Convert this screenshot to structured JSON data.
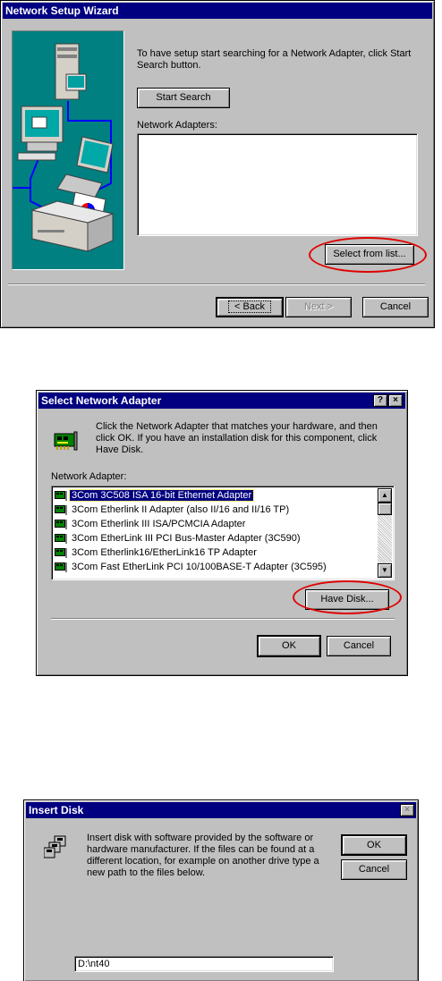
{
  "wizard": {
    "title": "Network Setup Wizard",
    "instruction": "To have setup start searching for a Network Adapter, click Start Search button.",
    "start_search_button": "Start Search",
    "adapters_label": "Network Adapters:",
    "adapters_list": [],
    "select_from_list_button": "Select from list...",
    "back_button": "< Back",
    "next_button": "Next >",
    "cancel_button": "Cancel"
  },
  "select_adapter": {
    "title": "Select Network Adapter",
    "help_button": "?",
    "close_button": "×",
    "instruction": "Click the Network Adapter that matches your hardware, and then click OK.  If you have an installation disk for this component, click Have Disk.",
    "list_label": "Network Adapter:",
    "adapters": [
      "3Com 3C508 ISA 16-bit Ethernet Adapter",
      "3Com Etherlink II Adapter (also II/16 and II/16 TP)",
      "3Com Etherlink III ISA/PCMCIA Adapter",
      "3Com EtherLink III PCI Bus-Master Adapter (3C590)",
      "3Com Etherlink16/EtherLink16 TP Adapter",
      "3Com Fast EtherLink PCI 10/100BASE-T Adapter (3C595)"
    ],
    "selected_index": 0,
    "have_disk_button": "Have Disk...",
    "ok_button": "OK",
    "cancel_button": "Cancel"
  },
  "insert_disk": {
    "title": "Insert Disk",
    "close_button": "×",
    "message": "Insert disk with software provided by the software or hardware manufacturer.  If the files can be found at a different location, for example on another drive type a new path to the files below.",
    "ok_button": "OK",
    "cancel_button": "Cancel",
    "path_value": "D:\\nt40"
  },
  "colors": {
    "title_bar": "#000080",
    "face": "#c0c0c0",
    "wizard_art_bg": "#008080",
    "annotation_ring": "#e00000"
  }
}
